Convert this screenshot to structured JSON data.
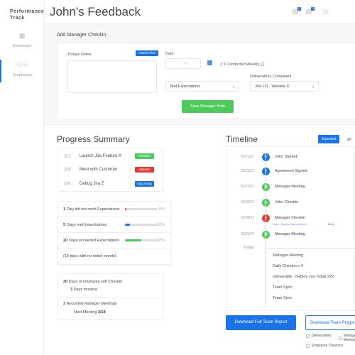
{
  "sidebar": {
    "brand": "Performance Track",
    "items": [
      {
        "label": "Dashboard",
        "icon": "dashboard-icon"
      },
      {
        "label": "Employees",
        "icon": "employees-icon",
        "active": true
      }
    ]
  },
  "header": {
    "title": "John's Feedback",
    "notifications": [
      {
        "icon": "bell-icon",
        "count": "0"
      },
      {
        "icon": "mail-icon",
        "count": "0"
      },
      {
        "icon": "chat-icon"
      }
    ]
  },
  "checkin": {
    "title": "Add Manager Checkin",
    "notes_label": "Todays Notes",
    "notes_value": "",
    "attach_label": "Attach Files",
    "date_label": "Date",
    "date_value": "/     /",
    "weekly_label": "1:1 Conducted Weekly",
    "weekly_checked": false,
    "expectation_value": "Met Expectations",
    "deliverables_label": "Deliverables Completed",
    "deliverables_value": "Jira 111 , Website X",
    "save_label": "Save Manager Note"
  },
  "progress": {
    "title": "Progress Summary",
    "tasks": [
      {
        "date": "3/1",
        "name": "Launch Jira Feature X",
        "status": "Finished",
        "color": "#4cca5c"
      },
      {
        "date": "3/5",
        "name": "Meet with Customer",
        "status": "Missed",
        "color": "#e53935"
      },
      {
        "date": "3/5",
        "name": "Debug Jira Z",
        "status": "Upcoming",
        "color": "#1a73e8"
      }
    ],
    "stats": [
      {
        "count": "1",
        "label": "Day did not meet Expectations",
        "percent": 5,
        "percent_label": "5%",
        "color": "#e53935"
      },
      {
        "count": "5",
        "label": "Days met Expectations",
        "percent": 15,
        "percent_label": "15%",
        "color": "#1a73e8"
      },
      {
        "count": "20",
        "label": "Days exceeded Expectations",
        "percent": 50,
        "percent_label": "50%",
        "color": "#4cca5c"
      }
    ],
    "no_events": "(15 days with no noted events)",
    "self_checkin_count": "20",
    "self_checkin_label": "Days of employee self Checkin",
    "missing_count": "3",
    "missing_label": "Days missing",
    "meetings_count": "3",
    "meetings_label": "Recorded Manager Meetings",
    "next_meeting_label": "Next Meeting",
    "next_meeting_date": "3/18"
  },
  "timeline": {
    "title": "Timeline",
    "tab_important": "Important",
    "tab_all": "All",
    "events": [
      {
        "date": "02/21/17",
        "name": "John Started",
        "icon": "power-icon",
        "glyph": "⏻",
        "color": "#1a73e8"
      },
      {
        "date": "02/23/17",
        "name": "Agreement Signed",
        "icon": "pen-icon",
        "glyph": "✎",
        "color": "#1a73e8"
      },
      {
        "date": "02/25/17",
        "name": "Manager Meeting",
        "icon": "calendar-icon",
        "glyph": "▦",
        "color": "#4cca5c"
      },
      {
        "date": "03/02/17",
        "name": "John Checkin",
        "icon": "clock-icon",
        "glyph": "◷",
        "color": "#4cca5c"
      },
      {
        "date": "03/08/17",
        "name": "Manager Checkin",
        "icon": "user-icon",
        "glyph": "●",
        "color": "#e53935"
      },
      {
        "date": "02/25/17",
        "name": "Manager Meeting",
        "icon": "calendar-icon",
        "glyph": "▦",
        "color": "#4cca5c"
      }
    ],
    "note": "Note : Needs Improvement",
    "more": "More",
    "today_label": "Today",
    "today_items": [
      "Manager Meeting",
      "Daily Checkin x 4",
      "Deliverable : Deploy Jira Ticket 222",
      "Team Sync",
      "Team Sync"
    ]
  },
  "downloads": {
    "full_report": "Download Full Team Report",
    "team_progress": "Download Team Progress",
    "options": [
      "Deliverables",
      "Manager Meetings",
      "Employee Checkins"
    ]
  }
}
